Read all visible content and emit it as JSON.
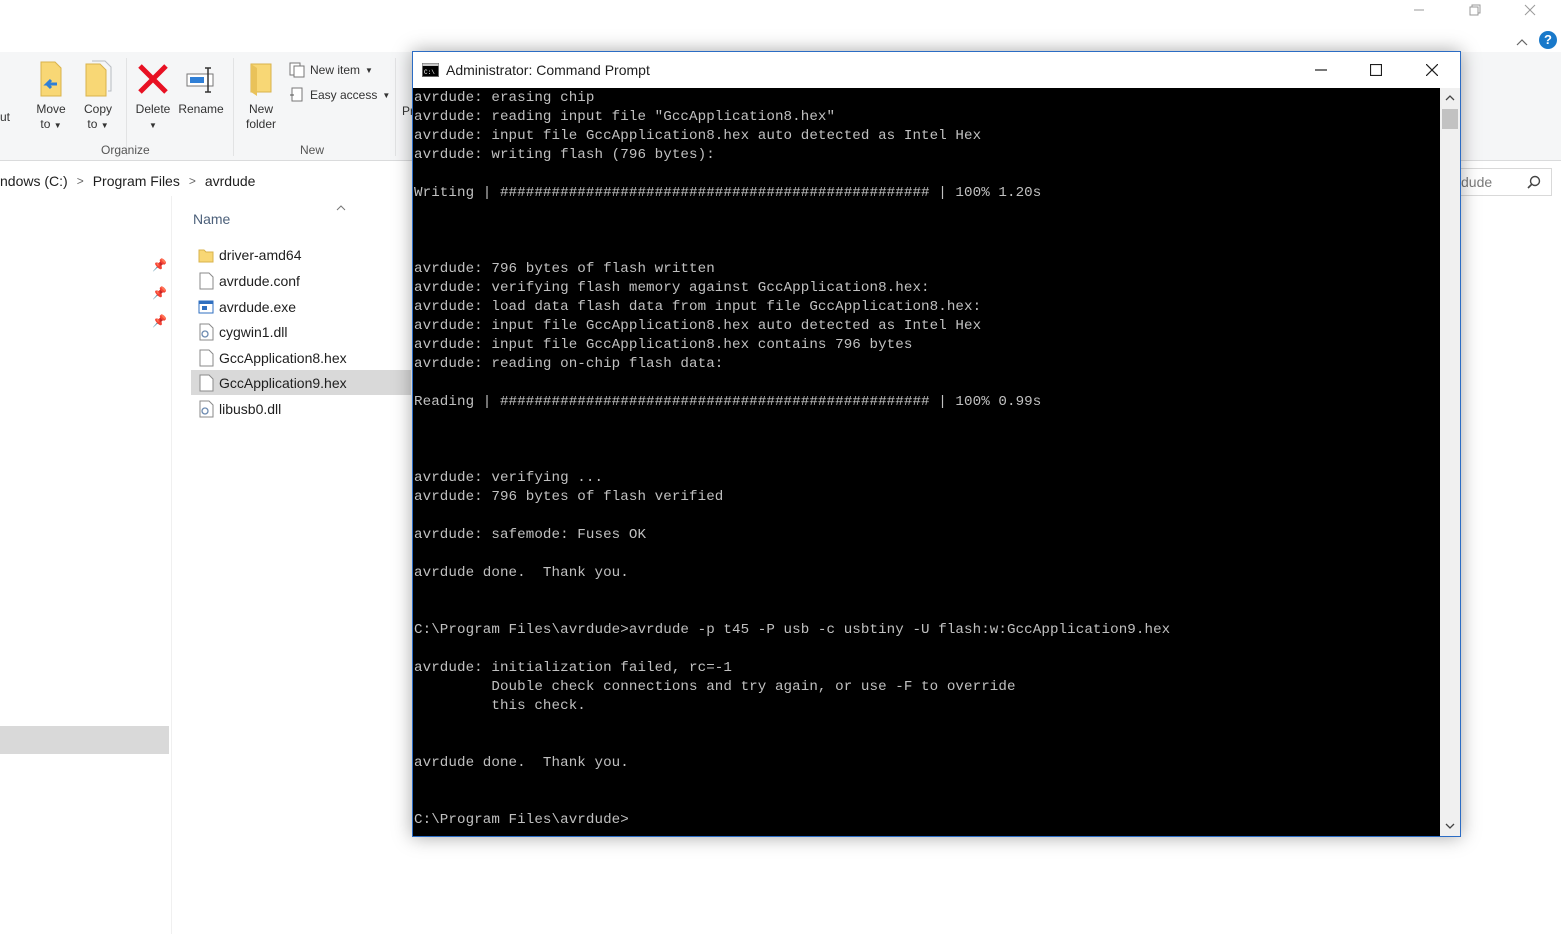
{
  "explorer": {
    "ribbon": {
      "cut_label": "ut",
      "move_to_label": "Move",
      "move_to_label2": "to",
      "copy_to_label": "Copy",
      "copy_to_label2": "to",
      "delete_label": "Delete",
      "rename_label": "Rename",
      "new_folder_label": "New",
      "new_folder_label2": "folder",
      "new_item_label": "New item",
      "easy_access_label": "Easy access",
      "properties_partial": "Pr",
      "organize_group": "Organize",
      "new_group": "New"
    },
    "address": {
      "segments": [
        "ndows (C:)",
        "Program Files",
        "avrdude"
      ]
    },
    "search": {
      "placeholder_partial": "dude"
    },
    "column_header": "Name",
    "files": [
      {
        "name": "driver-amd64",
        "icon": "folder-icon",
        "selected": false
      },
      {
        "name": "avrdude.conf",
        "icon": "file-icon",
        "selected": false
      },
      {
        "name": "avrdude.exe",
        "icon": "exe-icon",
        "selected": false
      },
      {
        "name": "cygwin1.dll",
        "icon": "dll-icon",
        "selected": false
      },
      {
        "name": "GccApplication8.hex",
        "icon": "file-icon",
        "selected": false
      },
      {
        "name": "GccApplication9.hex",
        "icon": "file-icon",
        "selected": true
      },
      {
        "name": "libusb0.dll",
        "icon": "dll-icon",
        "selected": false
      }
    ]
  },
  "cmd": {
    "title": "Administrator: Command Prompt",
    "lines": [
      "avrdude: erasing chip",
      "avrdude: reading input file \"GccApplication8.hex\"",
      "avrdude: input file GccApplication8.hex auto detected as Intel Hex",
      "avrdude: writing flash (796 bytes):",
      "",
      "Writing | ################################################## | 100% 1.20s",
      "",
      "",
      "",
      "avrdude: 796 bytes of flash written",
      "avrdude: verifying flash memory against GccApplication8.hex:",
      "avrdude: load data flash data from input file GccApplication8.hex:",
      "avrdude: input file GccApplication8.hex auto detected as Intel Hex",
      "avrdude: input file GccApplication8.hex contains 796 bytes",
      "avrdude: reading on-chip flash data:",
      "",
      "Reading | ################################################## | 100% 0.99s",
      "",
      "",
      "",
      "avrdude: verifying ...",
      "avrdude: 796 bytes of flash verified",
      "",
      "avrdude: safemode: Fuses OK",
      "",
      "avrdude done.  Thank you.",
      "",
      "",
      "C:\\Program Files\\avrdude>avrdude -p t45 -P usb -c usbtiny -U flash:w:GccApplication9.hex",
      "",
      "avrdude: initialization failed, rc=-1",
      "         Double check connections and try again, or use -F to override",
      "         this check.",
      "",
      "",
      "avrdude done.  Thank you.",
      "",
      "",
      "C:\\Program Files\\avrdude>"
    ]
  },
  "colors": {
    "console_bg": "#000000",
    "console_text": "#c0c0c0",
    "window_border": "#2b6cc4",
    "delete_red": "#e81123",
    "folder_yellow": "#f8d775",
    "help_blue": "#1979ca"
  }
}
